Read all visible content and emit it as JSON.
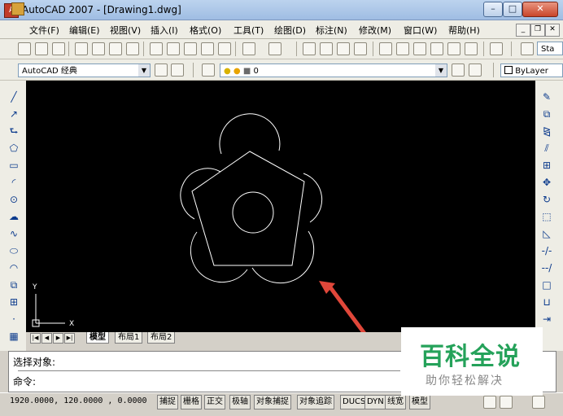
{
  "window": {
    "title": "AutoCAD 2007 - [Drawing1.dwg]",
    "app_icon_label": "A"
  },
  "window_controls": {
    "minimize": "–",
    "maximize": "□",
    "close": "✕"
  },
  "menu": [
    "文件(F)",
    "编辑(E)",
    "视图(V)",
    "插入(I)",
    "格式(O)",
    "工具(T)",
    "绘图(D)",
    "标注(N)",
    "修改(M)",
    "窗口(W)",
    "帮助(H)"
  ],
  "mdi_controls": {
    "minimize": "_",
    "restore": "❐",
    "close": "✕"
  },
  "toolbar": {
    "style_partial": "Sta"
  },
  "workspace": {
    "selected": "AutoCAD 经典"
  },
  "layer": {
    "selected": "0"
  },
  "color_combo": {
    "selected": "ByLayer"
  },
  "ucs": {
    "x_label": "X",
    "y_label": "Y"
  },
  "layout_tabs": [
    "模型",
    "布局1",
    "布局2"
  ],
  "nav_buttons": [
    "|◀",
    "◀",
    "▶",
    "▶|"
  ],
  "command": {
    "history_line": "选择对象:",
    "prompt": "命令:"
  },
  "status": {
    "coordinates": "1920.0000, 120.0000 , 0.0000",
    "toggles": [
      "捕捉",
      "栅格",
      "正交",
      "极轴",
      "对象捕捉",
      "对象追踪",
      "DUCS",
      "DYN",
      "线宽",
      "模型"
    ]
  },
  "watermark": {
    "title": "百科全说",
    "subtitle": "助你轻松解决"
  },
  "colors": {
    "canvas": "#000000",
    "geometry": "#ffffff",
    "arrow": "#e0473a",
    "watermark_green": "#25a25a"
  }
}
